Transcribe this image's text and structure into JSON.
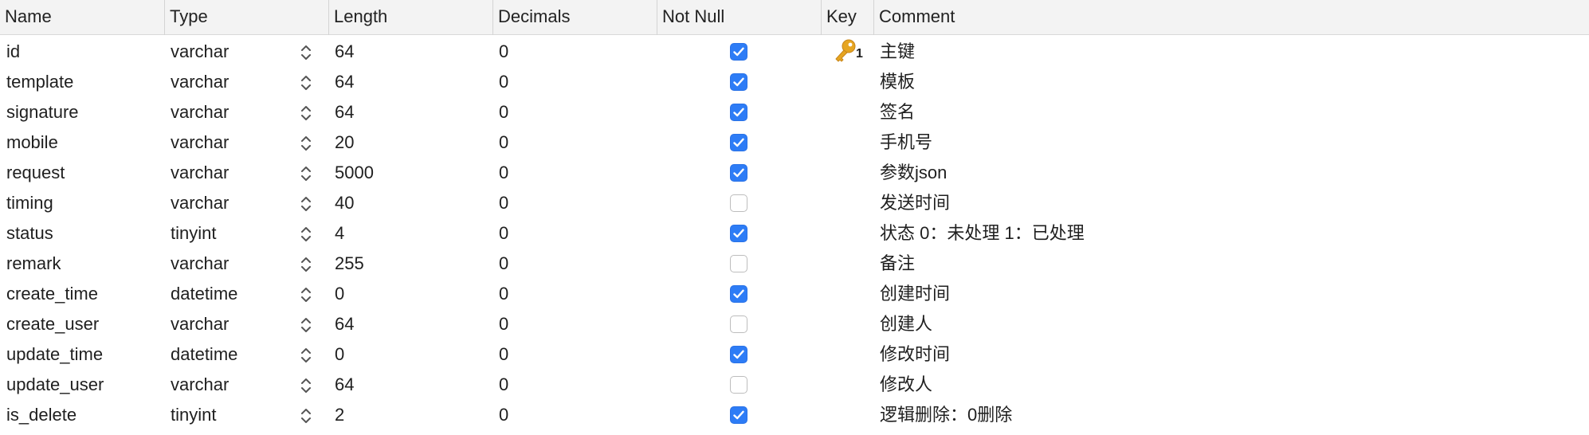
{
  "columns": {
    "name": "Name",
    "type": "Type",
    "length": "Length",
    "decimals": "Decimals",
    "not_null": "Not Null",
    "key": "Key",
    "comment": "Comment"
  },
  "rows": [
    {
      "name": "id",
      "type": "varchar",
      "length": "64",
      "decimals": "0",
      "not_null": true,
      "key": "1",
      "comment": "主键"
    },
    {
      "name": "template",
      "type": "varchar",
      "length": "64",
      "decimals": "0",
      "not_null": true,
      "key": "",
      "comment": "模板"
    },
    {
      "name": "signature",
      "type": "varchar",
      "length": "64",
      "decimals": "0",
      "not_null": true,
      "key": "",
      "comment": "签名"
    },
    {
      "name": "mobile",
      "type": "varchar",
      "length": "20",
      "decimals": "0",
      "not_null": true,
      "key": "",
      "comment": "手机号"
    },
    {
      "name": "request",
      "type": "varchar",
      "length": "5000",
      "decimals": "0",
      "not_null": true,
      "key": "",
      "comment": "参数json"
    },
    {
      "name": "timing",
      "type": "varchar",
      "length": "40",
      "decimals": "0",
      "not_null": false,
      "key": "",
      "comment": "发送时间"
    },
    {
      "name": "status",
      "type": "tinyint",
      "length": "4",
      "decimals": "0",
      "not_null": true,
      "key": "",
      "comment": "状态 0：未处理 1：已处理"
    },
    {
      "name": "remark",
      "type": "varchar",
      "length": "255",
      "decimals": "0",
      "not_null": false,
      "key": "",
      "comment": "备注"
    },
    {
      "name": "create_time",
      "type": "datetime",
      "length": "0",
      "decimals": "0",
      "not_null": true,
      "key": "",
      "comment": "创建时间"
    },
    {
      "name": "create_user",
      "type": "varchar",
      "length": "64",
      "decimals": "0",
      "not_null": false,
      "key": "",
      "comment": "创建人"
    },
    {
      "name": "update_time",
      "type": "datetime",
      "length": "0",
      "decimals": "0",
      "not_null": true,
      "key": "",
      "comment": "修改时间"
    },
    {
      "name": "update_user",
      "type": "varchar",
      "length": "64",
      "decimals": "0",
      "not_null": false,
      "key": "",
      "comment": "修改人"
    },
    {
      "name": "is_delete",
      "type": "tinyint",
      "length": "2",
      "decimals": "0",
      "not_null": true,
      "key": "",
      "comment": "逻辑删除：0删除"
    }
  ],
  "icons": {
    "type_stepper": "chevron-up-down-icon",
    "primary_key": "key-icon"
  },
  "colors": {
    "checkbox_checked": "#2d7cf6",
    "key_icon": "#e6a521",
    "header_bg": "#f3f3f3"
  }
}
